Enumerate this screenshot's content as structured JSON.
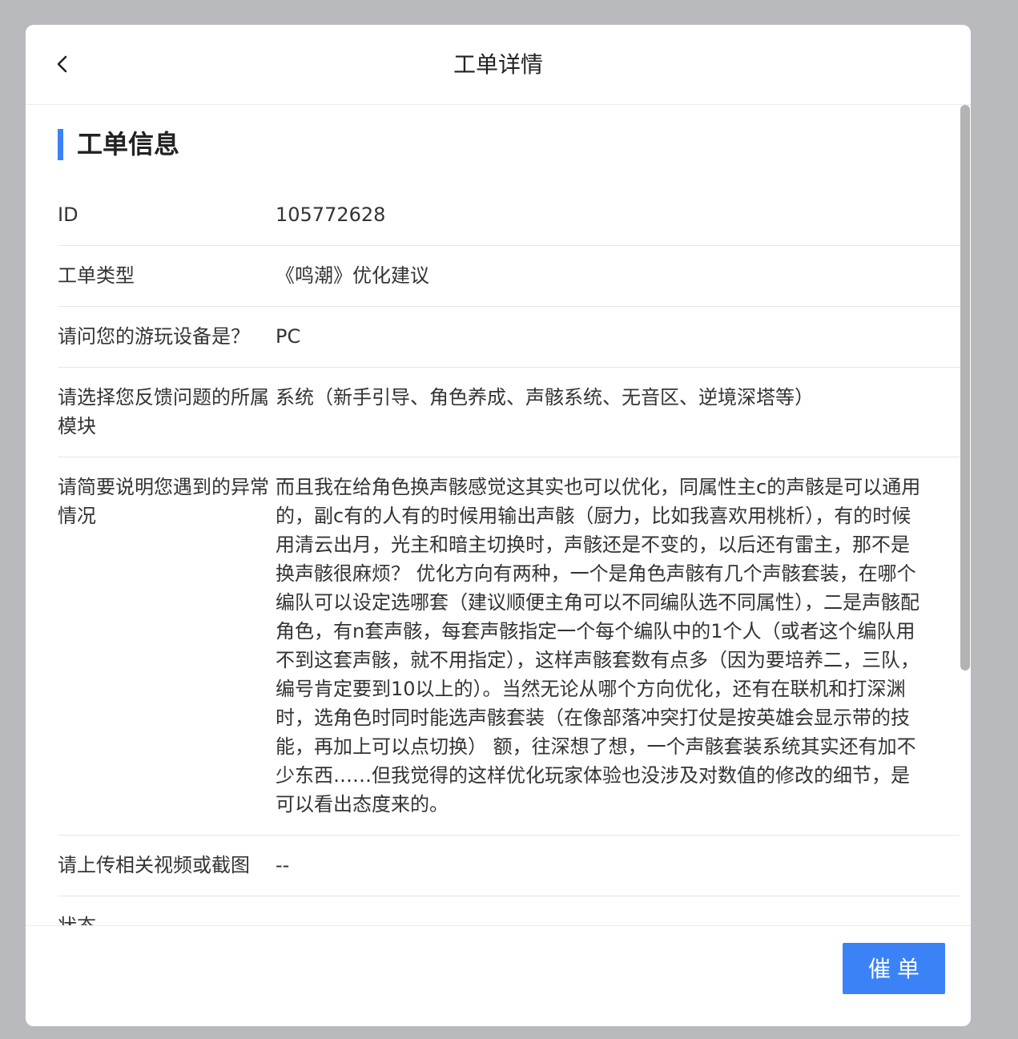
{
  "header": {
    "title": "工单详情"
  },
  "section": {
    "title": "工单信息"
  },
  "rows": [
    {
      "label": "ID",
      "value": "105772628"
    },
    {
      "label": "工单类型",
      "value": "《鸣潮》优化建议"
    },
    {
      "label": "请问您的游玩设备是？",
      "value": "PC"
    },
    {
      "label": "请选择您反馈问题的所属模块",
      "value": "系统（新手引导、角色养成、声骸系统、无音区、逆境深塔等）"
    },
    {
      "label": "请简要说明您遇到的异常情况",
      "value": "而且我在给角色换声骸感觉这其实也可以优化，同属性主c的声骸是可以通用的，副c有的人有的时候用输出声骸（厨力，比如我喜欢用桃析），有的时候用清云出月，光主和暗主切换时，声骸还是不变的，以后还有雷主，那不是换声骸很麻烦？ 优化方向有两种，一个是角色声骸有几个声骸套装，在哪个编队可以设定选哪套（建议顺便主角可以不同编队选不同属性），二是声骸配角色，有n套声骸，每套声骸指定一个每个编队中的1个人（或者这个编队用不到这套声骸，就不用指定），这样声骸套数有点多（因为要培养二，三队，编号肯定要到10以上的）。当然无论从哪个方向优化，还有在联机和打深渊时，选角色时同时能选声骸套装（在像部落冲突打仗是按英雄会显示带的技能，再加上可以点切换） 额，往深想了想，一个声骸套装系统其实还有加不少东西……但我觉得的这样优化玩家体验也没涉及对数值的修改的细节，是可以看出态度来的。"
    },
    {
      "label": "请上传相关视频或截图",
      "value": "--"
    },
    {
      "label": "状态",
      "value": ""
    }
  ],
  "footer": {
    "urge_label": "催单"
  },
  "colors": {
    "accent": "#3b82f6",
    "backdrop": "#b9babe"
  },
  "icons": {
    "back": "chevron-left-icon"
  }
}
